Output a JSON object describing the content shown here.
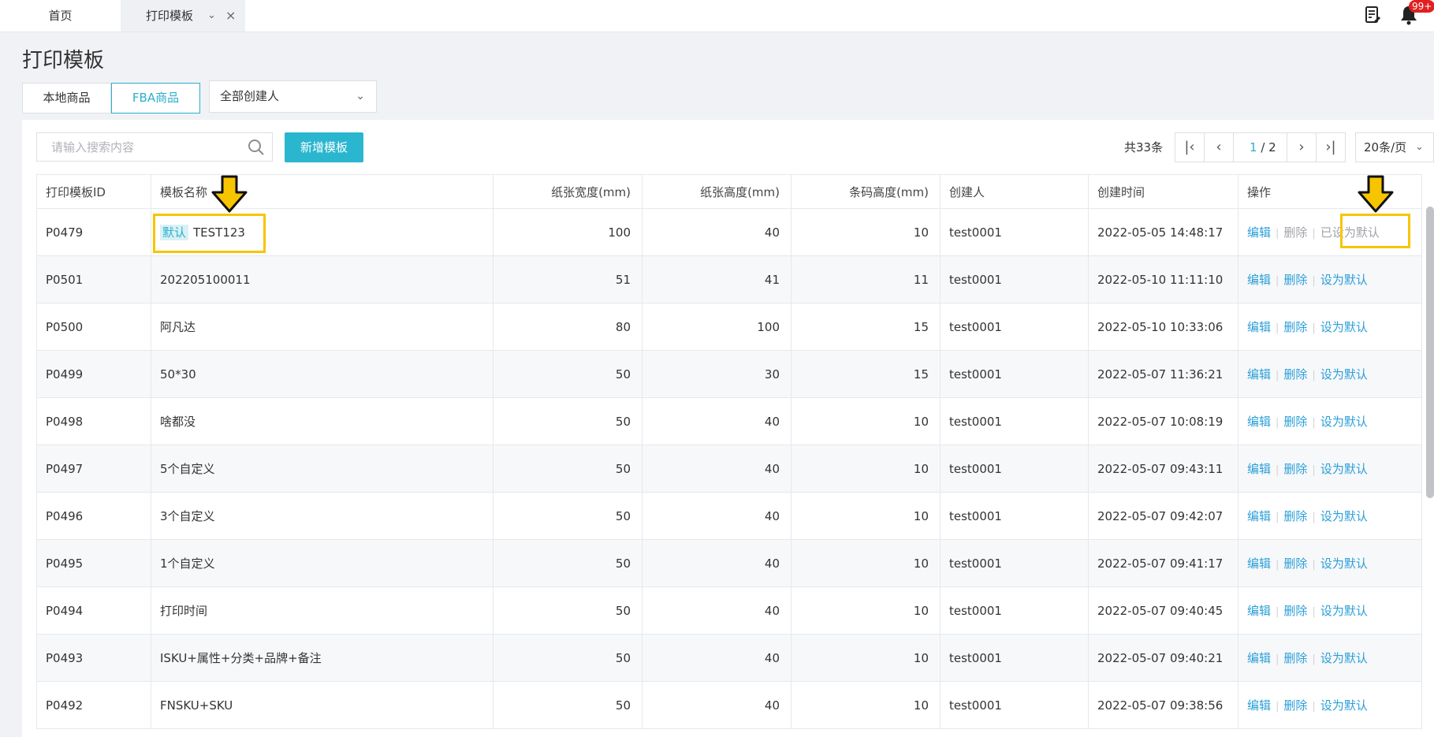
{
  "tabs": {
    "home": "首页",
    "active": "打印模板"
  },
  "notifications": {
    "badge": "99+"
  },
  "page": {
    "title": "打印模板"
  },
  "subtabs": [
    "本地商品",
    "FBA商品"
  ],
  "creator_filter": {
    "value": "全部创建人"
  },
  "search": {
    "placeholder": "请输入搜索内容",
    "value": ""
  },
  "add_button": "新增模板",
  "pagination": {
    "total": "共33条",
    "current": "1",
    "pages": "/ 2",
    "per_page": "20条/页"
  },
  "table": {
    "headers": [
      "打印模板ID",
      "模板名称",
      "纸张宽度(mm)",
      "纸张高度(mm)",
      "条码高度(mm)",
      "创建人",
      "创建时间",
      "操作"
    ],
    "default_tag": "默认",
    "actions": {
      "edit": "编辑",
      "delete": "删除",
      "set_default": "设为默认",
      "already_default": "已设为默认"
    },
    "rows": [
      {
        "id": "P0479",
        "name": "TEST123",
        "width": "100",
        "height": "40",
        "barcode": "10",
        "creator": "test0001",
        "created": "2022-05-05 14:48:17",
        "is_default": true
      },
      {
        "id": "P0501",
        "name": "202205100011",
        "width": "51",
        "height": "41",
        "barcode": "11",
        "creator": "test0001",
        "created": "2022-05-10 11:11:10",
        "is_default": false
      },
      {
        "id": "P0500",
        "name": "阿凡达",
        "width": "80",
        "height": "100",
        "barcode": "15",
        "creator": "test0001",
        "created": "2022-05-10 10:33:06",
        "is_default": false
      },
      {
        "id": "P0499",
        "name": "50*30",
        "width": "50",
        "height": "30",
        "barcode": "15",
        "creator": "test0001",
        "created": "2022-05-07 11:36:21",
        "is_default": false
      },
      {
        "id": "P0498",
        "name": "啥都没",
        "width": "50",
        "height": "40",
        "barcode": "10",
        "creator": "test0001",
        "created": "2022-05-07 10:08:19",
        "is_default": false
      },
      {
        "id": "P0497",
        "name": "5个自定义",
        "width": "50",
        "height": "40",
        "barcode": "10",
        "creator": "test0001",
        "created": "2022-05-07 09:43:11",
        "is_default": false
      },
      {
        "id": "P0496",
        "name": "3个自定义",
        "width": "50",
        "height": "40",
        "barcode": "10",
        "creator": "test0001",
        "created": "2022-05-07 09:42:07",
        "is_default": false
      },
      {
        "id": "P0495",
        "name": "1个自定义",
        "width": "50",
        "height": "40",
        "barcode": "10",
        "creator": "test0001",
        "created": "2022-05-07 09:41:17",
        "is_default": false
      },
      {
        "id": "P0494",
        "name": "打印时间",
        "width": "50",
        "height": "40",
        "barcode": "10",
        "creator": "test0001",
        "created": "2022-05-07 09:40:45",
        "is_default": false
      },
      {
        "id": "P0493",
        "name": "ISKU+属性+分类+品牌+备注",
        "width": "50",
        "height": "40",
        "barcode": "10",
        "creator": "test0001",
        "created": "2022-05-07 09:40:21",
        "is_default": false
      },
      {
        "id": "P0492",
        "name": "FNSKU+SKU",
        "width": "50",
        "height": "40",
        "barcode": "10",
        "creator": "test0001",
        "created": "2022-05-07 09:38:56",
        "is_default": false
      }
    ]
  },
  "icons": {
    "doc": "document-edit-icon",
    "bell": "bell-icon",
    "search": "search-icon",
    "annotation_arrow": "down-arrow-icon"
  },
  "colors": {
    "accent": "#2bb0cc",
    "link": "#2b9fd8",
    "highlight": "#f7c500",
    "badge": "#e02020"
  }
}
